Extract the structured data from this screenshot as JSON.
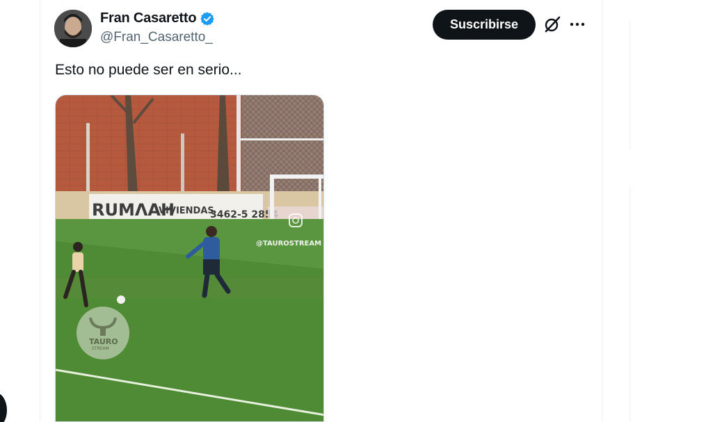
{
  "tweet": {
    "author_name": "Fran Casaretto",
    "author_handle": "@Fran_Casaretto_",
    "verified": true,
    "text": "Esto no puede ser en serio..."
  },
  "actions": {
    "subscribe_label": "Suscribirse",
    "grok_icon": "grok-icon",
    "more_icon": "more-icon"
  },
  "media": {
    "banner_brand": "RUΜΛAH",
    "banner_sub": "VIVIENDAS",
    "banner_phone": "3462-5 2854",
    "watermark_handle": "@TAUROSTREAM",
    "watermark_logo_text": "TAURO",
    "watermark_logo_sub": "STREAM"
  },
  "colors": {
    "verified_blue": "#1d9bf0",
    "subscribe_bg": "#0f1419",
    "handle_gray": "#536471",
    "pitch_green": "#4f8a35",
    "wall_brick": "#b5593f"
  }
}
